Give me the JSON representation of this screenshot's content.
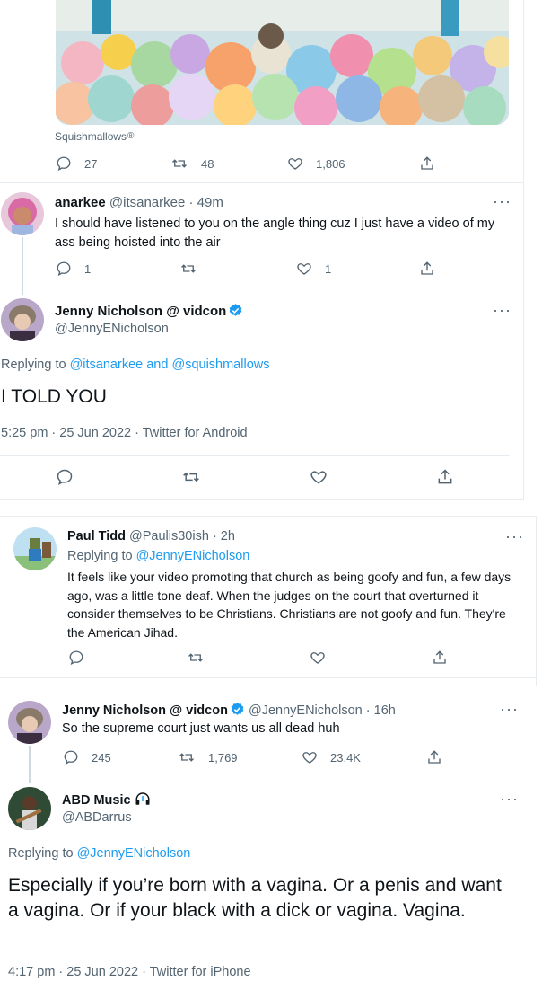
{
  "colors": {
    "link": "#1d9bf0",
    "muted": "#536471",
    "divider": "#e6ecf0"
  },
  "embed": {
    "caption": "Squishmallows",
    "registered_mark": "®"
  },
  "tweet_quoted": {
    "replies": "27",
    "retweets": "48",
    "likes": "1,806"
  },
  "reply_anarkee": {
    "name": "anarkee",
    "handle": "@itsanarkee",
    "time": "· 49m",
    "text": "I should have listened to you on the angle thing cuz I just have a video of my ass being hoisted into the air",
    "replies": "1",
    "likes": "1"
  },
  "main_tweet": {
    "name": "Jenny Nicholson @ vidcon",
    "handle": "@JennyENicholson",
    "replying_prefix": "Replying to",
    "reply_to_1": "@itsanarkee",
    "reply_and": "and",
    "reply_to_2": "@squishmallows",
    "text": "I TOLD YOU",
    "meta": "5:25 pm · 25 Jun 2022 · Twitter for Android"
  },
  "reply_paul": {
    "name": "Paul Tidd",
    "handle": "@Paulis30ish",
    "time": "· 2h",
    "replying_prefix": "Replying to",
    "reply_to": "@JennyENicholson",
    "text": "It feels like your video promoting that church as being goofy and fun, a few days ago, was a little tone deaf. When the judges on the court that overturned it consider themselves to be Christians. Christians are not goofy and fun. They're the American Jihad."
  },
  "tweet_jenny2": {
    "name": "Jenny Nicholson @ vidcon",
    "handle": "@JennyENicholson",
    "time": "· 16h",
    "text": "So the supreme court just wants us all dead huh",
    "replies": "245",
    "retweets": "1,769",
    "likes": "23.4K"
  },
  "tweet_abd": {
    "name": "ABD Music",
    "handle": "@ABDarrus",
    "replying_prefix": "Replying to",
    "reply_to": "@JennyENicholson",
    "text": "Especially if you’re born with a vagina. Or a penis and want a vagina. Or if your black with a dick or vagina. Vagina.",
    "meta": "4:17 pm · 25 Jun 2022 · Twitter for iPhone"
  }
}
